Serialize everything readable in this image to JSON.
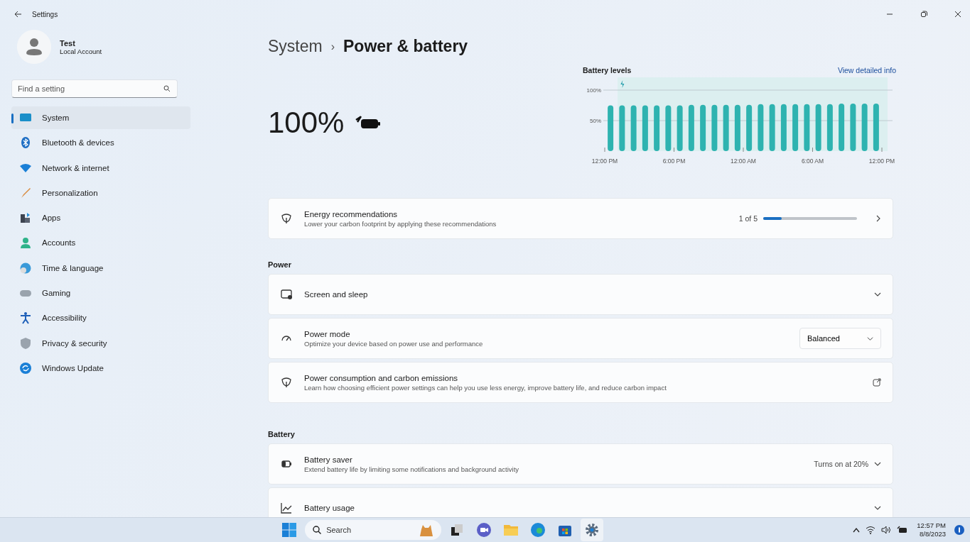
{
  "window": {
    "title": "Settings"
  },
  "account": {
    "name": "Test",
    "type": "Local Account"
  },
  "search": {
    "placeholder": "Find a setting"
  },
  "sidebar": {
    "items": [
      {
        "label": "System",
        "selected": true
      },
      {
        "label": "Bluetooth & devices",
        "selected": false
      },
      {
        "label": "Network & internet",
        "selected": false
      },
      {
        "label": "Personalization",
        "selected": false
      },
      {
        "label": "Apps",
        "selected": false
      },
      {
        "label": "Accounts",
        "selected": false
      },
      {
        "label": "Time & language",
        "selected": false
      },
      {
        "label": "Gaming",
        "selected": false
      },
      {
        "label": "Accessibility",
        "selected": false
      },
      {
        "label": "Privacy & security",
        "selected": false
      },
      {
        "label": "Windows Update",
        "selected": false
      }
    ]
  },
  "breadcrumb": {
    "parent": "System",
    "separator": "›",
    "current": "Power & battery"
  },
  "battery": {
    "percent": "100%"
  },
  "battery_chart": {
    "title": "Battery levels",
    "link": "View detailed info",
    "chart_data": {
      "type": "bar",
      "categories": [
        "12:00 PM",
        null,
        null,
        null,
        null,
        null,
        "6:00 PM",
        null,
        null,
        null,
        null,
        null,
        "12:00 AM",
        null,
        null,
        null,
        null,
        null,
        "6:00 AM",
        null,
        null,
        null,
        null,
        null,
        "12:00 PM"
      ],
      "values": [
        75,
        75,
        75,
        75,
        75,
        75,
        75,
        76,
        76,
        76,
        76,
        76,
        76,
        77,
        77,
        77,
        77,
        77,
        77,
        77,
        78,
        78,
        78,
        78,
        null
      ],
      "ylim": [
        0,
        100
      ],
      "yticks": [
        {
          "value": 50,
          "label": "50%"
        },
        {
          "value": 100,
          "label": "100%"
        }
      ]
    }
  },
  "energy_card": {
    "kind": "progress",
    "title": "Energy recommendations",
    "description": "Lower your carbon footprint by applying these recommendations",
    "value": "1 of 5",
    "level": 0.2
  },
  "sections": [
    {
      "heading": "Power",
      "rows": [
        {
          "kind": "expand",
          "title": "Screen and sleep"
        },
        {
          "kind": "dropdown",
          "title": "Power mode",
          "description": "Optimize your device based on power use and performance",
          "value": "Balanced"
        },
        {
          "kind": "external",
          "title": "Power consumption and carbon emissions",
          "description": "Learn how choosing efficient power settings can help you use less energy, improve battery life, and reduce carbon impact"
        }
      ]
    },
    {
      "heading": "Battery",
      "rows": [
        {
          "kind": "expand",
          "title": "Battery saver",
          "description": "Extend battery life by limiting some notifications and background activity",
          "value": "Turns on at 20%"
        },
        {
          "kind": "expand",
          "title": "Battery usage"
        }
      ]
    }
  ],
  "taskbar": {
    "search_placeholder": "Search",
    "time": "12:57 PM",
    "date": "8/8/2023"
  }
}
